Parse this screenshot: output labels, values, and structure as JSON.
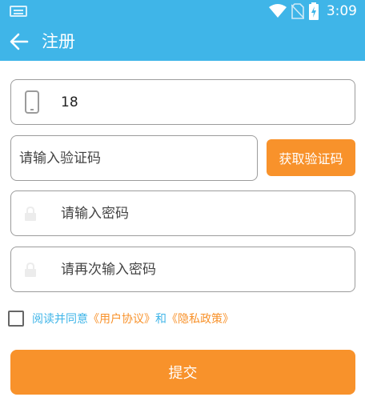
{
  "status_bar": {
    "time": "3:09"
  },
  "app_bar": {
    "title": "注册"
  },
  "form": {
    "phone_value": "18",
    "code_placeholder": "请输入验证码",
    "get_code_label": "获取验证码",
    "password_placeholder": "请输入密码",
    "confirm_placeholder": "请再次输入密码"
  },
  "agreement": {
    "prefix": "阅读并同意",
    "user_agreement": "《用户协议》",
    "conjunction": "和",
    "privacy_policy": "《隐私政策》"
  },
  "submit_label": "提交",
  "icons": {
    "status": [
      "keyboard-icon",
      "wifi-icon",
      "no-sim-icon",
      "battery-charging-icon"
    ],
    "back": "back-arrow-icon",
    "phone": "phone-icon",
    "lock": "lock-icon"
  },
  "colors": {
    "primary": "#3fb5e8",
    "accent": "#f8922b"
  }
}
